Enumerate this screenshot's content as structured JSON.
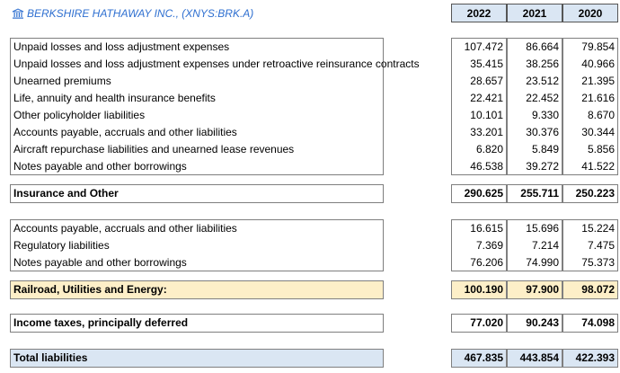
{
  "company": {
    "title": "BERKSHIRE HATHAWAY INC., (XNYS:BRK.A)",
    "icon": "bank-icon",
    "color": "#2e6fd0"
  },
  "years": [
    "2022",
    "2021",
    "2020"
  ],
  "section1": {
    "rows": [
      {
        "label": "Unpaid losses and loss adjustment expenses",
        "v": [
          "107.472",
          "86.664",
          "79.854"
        ]
      },
      {
        "label": "Unpaid losses and loss adjustment expenses under retroactive reinsurance contracts",
        "v": [
          "35.415",
          "38.256",
          "40.966"
        ]
      },
      {
        "label": "Unearned premiums",
        "v": [
          "28.657",
          "23.512",
          "21.395"
        ]
      },
      {
        "label": "Life, annuity and health insurance benefits",
        "v": [
          "22.421",
          "22.452",
          "21.616"
        ]
      },
      {
        "label": "Other policyholder liabilities",
        "v": [
          "10.101",
          "9.330",
          "8.670"
        ]
      },
      {
        "label": "Accounts payable, accruals and other liabilities",
        "v": [
          "33.201",
          "30.376",
          "30.344"
        ]
      },
      {
        "label": "Aircraft repurchase liabilities and unearned lease revenues",
        "v": [
          "6.820",
          "5.849",
          "5.856"
        ]
      },
      {
        "label": "Notes payable and other borrowings",
        "v": [
          "46.538",
          "39.272",
          "41.522"
        ]
      }
    ]
  },
  "total1": {
    "label": "Insurance and Other",
    "v": [
      "290.625",
      "255.711",
      "250.223"
    ]
  },
  "section2": {
    "rows": [
      {
        "label": "Accounts payable, accruals and other liabilities",
        "v": [
          "16.615",
          "15.696",
          "15.224"
        ]
      },
      {
        "label": "Regulatory liabilities",
        "v": [
          "7.369",
          "7.214",
          "7.475"
        ]
      },
      {
        "label": "Notes payable and other borrowings",
        "v": [
          "76.206",
          "74.990",
          "75.373"
        ]
      }
    ]
  },
  "total2": {
    "label": "Railroad, Utilities and Energy:",
    "v": [
      "100.190",
      "97.900",
      "98.072"
    ],
    "color": "#fdefc8"
  },
  "total3": {
    "label": "Income taxes, principally deferred",
    "v": [
      "77.020",
      "90.243",
      "74.098"
    ]
  },
  "total4": {
    "label": "Total liabilities",
    "v": [
      "467.835",
      "443.854",
      "422.393"
    ],
    "color": "#dae6f3"
  }
}
